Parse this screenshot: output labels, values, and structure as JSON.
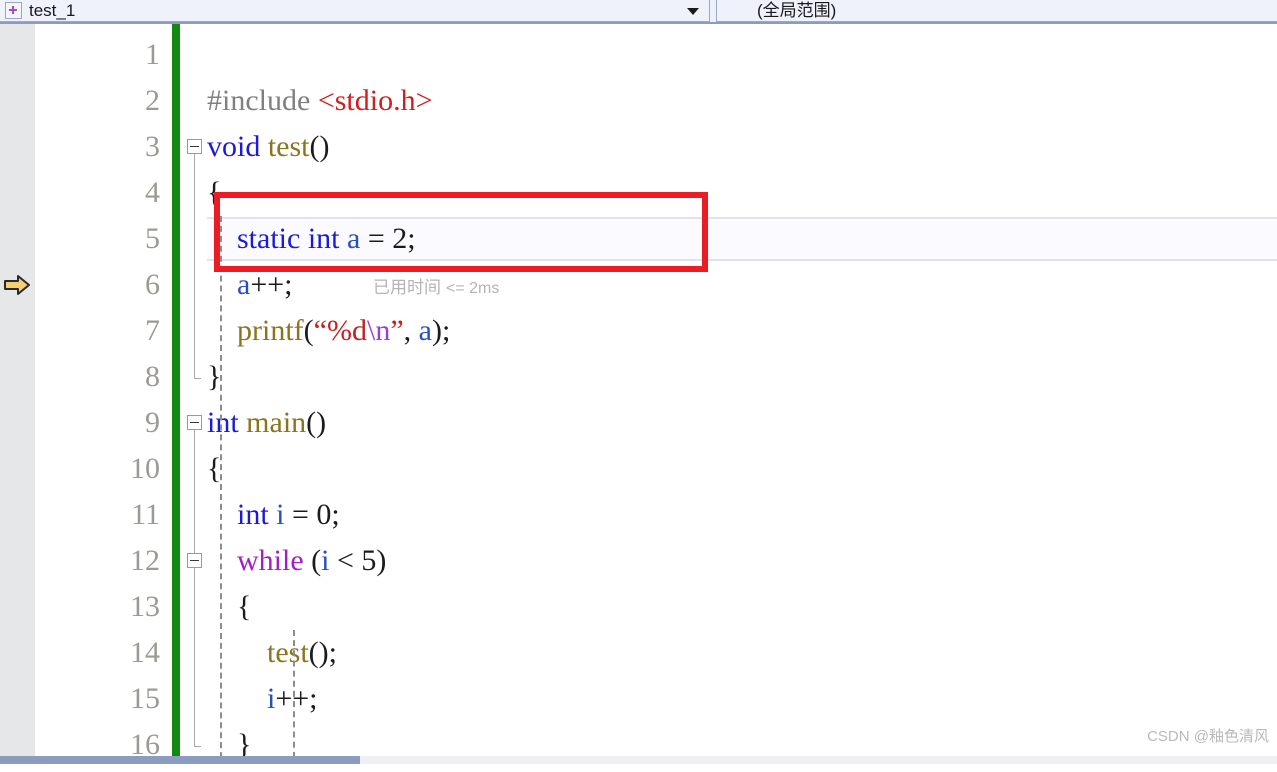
{
  "navbar": {
    "left_combo": {
      "icon": "c-file-icon",
      "value": "test_1",
      "arrow": "chevron-down-icon"
    },
    "right_combo": {
      "value": "(全局范围)"
    }
  },
  "editor": {
    "execution_marker": "execution-arrow-icon",
    "execution_marker_line": 6,
    "line_numbers": [
      "1",
      "2",
      "3",
      "4",
      "5",
      "6",
      "7",
      "8",
      "9",
      "10",
      "11",
      "12",
      "13",
      "14",
      "15",
      "16"
    ],
    "current_line": 5,
    "elapsed_time": {
      "label": "已用时间",
      "value": "<= 2ms"
    },
    "code": [
      {
        "line": 1,
        "text": ""
      },
      {
        "line": 2,
        "text": "#include <stdio.h>"
      },
      {
        "line": 3,
        "text": "void test()"
      },
      {
        "line": 4,
        "text": "{"
      },
      {
        "line": 5,
        "text": "    static int a = 2;"
      },
      {
        "line": 6,
        "text": "    a++;"
      },
      {
        "line": 7,
        "text": "    printf(\"%d\\n\", a);"
      },
      {
        "line": 8,
        "text": "}"
      },
      {
        "line": 9,
        "text": "int main()"
      },
      {
        "line": 10,
        "text": "{"
      },
      {
        "line": 11,
        "text": "    int i = 0;"
      },
      {
        "line": 12,
        "text": "    while (i < 5)"
      },
      {
        "line": 13,
        "text": "    {"
      },
      {
        "line": 14,
        "text": "        test();"
      },
      {
        "line": 15,
        "text": "        i++;"
      },
      {
        "line": 16,
        "text": "    }"
      }
    ],
    "fold_lines": [
      3,
      9,
      12
    ]
  },
  "annotation": {
    "red_box_target": "static int a = 2;"
  },
  "watermark": {
    "text": "CSDN @釉色清风"
  },
  "colors": {
    "keyword": "#1b1bd4",
    "control": "#a021c0",
    "function": "#8a7420",
    "string": "#c72020",
    "escape": "#9a3fd4",
    "preprocessor": "#808080",
    "include_path": "#d21e1e",
    "annotation_red": "#ec1c24",
    "change_bar_green": "#128912",
    "exec_arrow": "#f8cf73",
    "line_number": "#9c9a94"
  }
}
